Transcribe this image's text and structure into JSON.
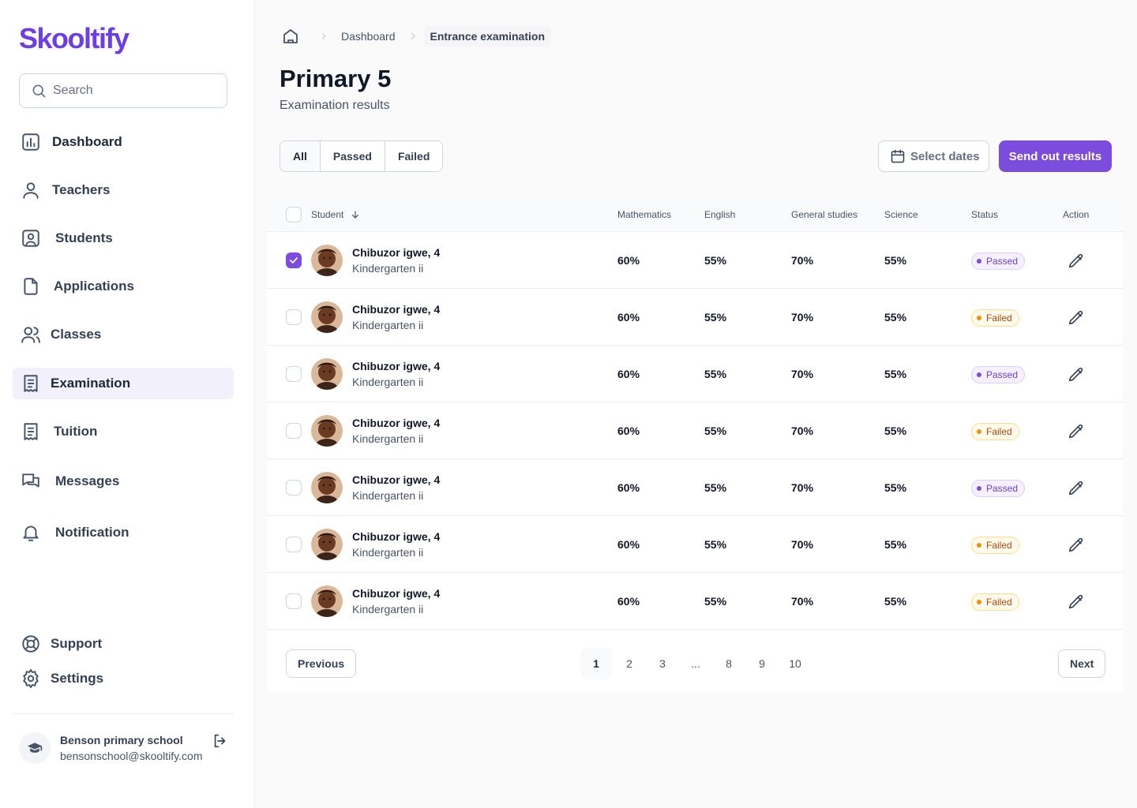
{
  "app": {
    "logo": "Skooltify"
  },
  "search": {
    "placeholder": "Search"
  },
  "sidebar": {
    "items": [
      {
        "label": "Dashboard",
        "icon": "bar-chart-icon"
      },
      {
        "label": "Teachers",
        "icon": "user-icon"
      },
      {
        "label": "Students",
        "icon": "user-square-icon"
      },
      {
        "label": "Applications",
        "icon": "file-icon"
      },
      {
        "label": "Classes",
        "icon": "users-icon"
      },
      {
        "label": "Examination",
        "icon": "receipt-icon",
        "active": true
      },
      {
        "label": "Tuition",
        "icon": "receipt-icon"
      },
      {
        "label": "Messages",
        "icon": "message-icon"
      },
      {
        "label": "Notification",
        "icon": "bell-icon"
      }
    ],
    "footer": [
      {
        "label": "Support",
        "icon": "life-buoy-icon"
      },
      {
        "label": "Settings",
        "icon": "gear-icon"
      }
    ],
    "account": {
      "name": "Benson primary school",
      "email": "bensonschool@skooltify.com"
    }
  },
  "breadcrumb": {
    "items": [
      "Dashboard",
      "Entrance examination"
    ]
  },
  "header": {
    "title": "Primary 5",
    "subtitle": "Examination results"
  },
  "filters": {
    "tabs": [
      "All",
      "Passed",
      "Failed"
    ],
    "selected": "All"
  },
  "actions": {
    "select_dates": "Select dates",
    "send": "Send out results"
  },
  "table": {
    "columns": [
      "Student",
      "Mathematics",
      "English",
      "General studies",
      "Science",
      "Status",
      "Action"
    ],
    "rows": [
      {
        "checked": true,
        "name": "Chibuzor igwe, 4",
        "class": "Kindergarten ii",
        "math": "60%",
        "english": "55%",
        "general": "70%",
        "science": "55%",
        "status": "Passed"
      },
      {
        "checked": false,
        "name": "Chibuzor igwe, 4",
        "class": "Kindergarten ii",
        "math": "60%",
        "english": "55%",
        "general": "70%",
        "science": "55%",
        "status": "Failed"
      },
      {
        "checked": false,
        "name": "Chibuzor igwe, 4",
        "class": "Kindergarten ii",
        "math": "60%",
        "english": "55%",
        "general": "70%",
        "science": "55%",
        "status": "Passed"
      },
      {
        "checked": false,
        "name": "Chibuzor igwe, 4",
        "class": "Kindergarten ii",
        "math": "60%",
        "english": "55%",
        "general": "70%",
        "science": "55%",
        "status": "Failed"
      },
      {
        "checked": false,
        "name": "Chibuzor igwe, 4",
        "class": "Kindergarten ii",
        "math": "60%",
        "english": "55%",
        "general": "70%",
        "science": "55%",
        "status": "Passed"
      },
      {
        "checked": false,
        "name": "Chibuzor igwe, 4",
        "class": "Kindergarten ii",
        "math": "60%",
        "english": "55%",
        "general": "70%",
        "science": "55%",
        "status": "Failed"
      },
      {
        "checked": false,
        "name": "Chibuzor igwe, 4",
        "class": "Kindergarten ii",
        "math": "60%",
        "english": "55%",
        "general": "70%",
        "science": "55%",
        "status": "Failed"
      }
    ]
  },
  "pagination": {
    "previous": "Previous",
    "next": "Next",
    "pages": [
      "1",
      "2",
      "3",
      "...",
      "8",
      "9",
      "10"
    ],
    "current": "1"
  },
  "colors": {
    "brand": "#7c4ddd",
    "passed": "#6d3ee6",
    "failed": "#b54708"
  }
}
